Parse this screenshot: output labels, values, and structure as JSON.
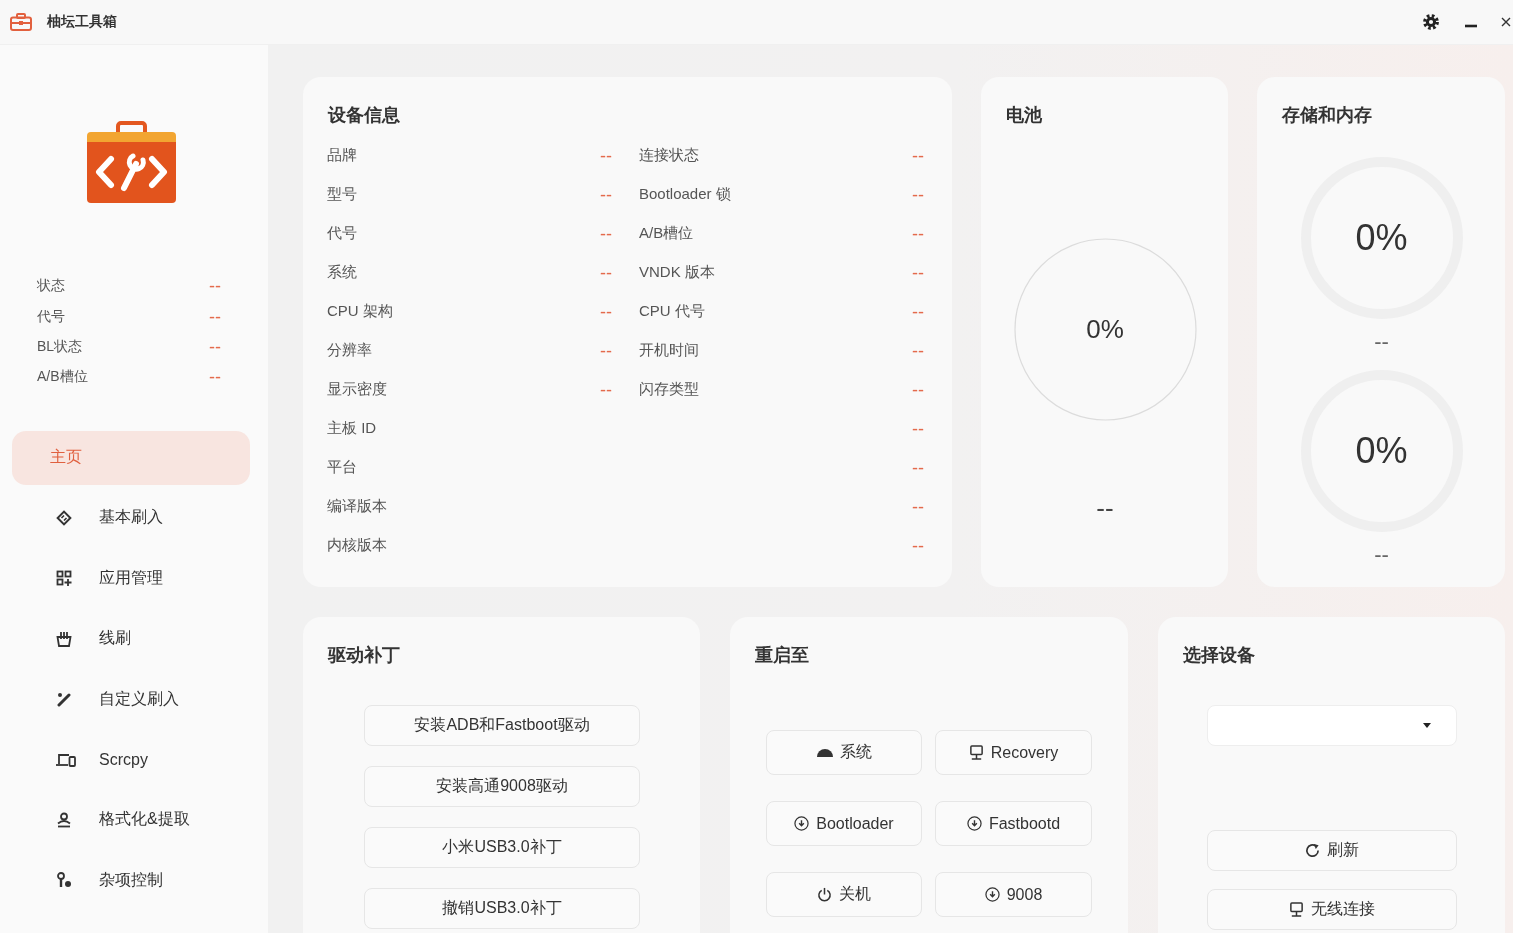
{
  "window": {
    "title": "柚坛工具箱"
  },
  "sidebar": {
    "status": [
      {
        "label": "状态",
        "value": "--"
      },
      {
        "label": "代号",
        "value": "--"
      },
      {
        "label": "BL状态",
        "value": "--"
      },
      {
        "label": "A/B槽位",
        "value": "--"
      }
    ],
    "nav": [
      {
        "label": "主页",
        "selected": true
      },
      {
        "label": "基本刷入",
        "selected": false
      },
      {
        "label": "应用管理",
        "selected": false
      },
      {
        "label": "线刷",
        "selected": false
      },
      {
        "label": "自定义刷入",
        "selected": false
      },
      {
        "label": "Scrcpy",
        "selected": false
      },
      {
        "label": "格式化&提取",
        "selected": false
      },
      {
        "label": "杂项控制",
        "selected": false
      }
    ]
  },
  "device_info": {
    "title": "设备信息",
    "rows": [
      {
        "cells": [
          {
            "label": "品牌",
            "value": "--"
          },
          {
            "label": "连接状态",
            "value": "--"
          }
        ]
      },
      {
        "cells": [
          {
            "label": "型号",
            "value": "--"
          },
          {
            "label": "Bootloader 锁",
            "value": "--"
          }
        ]
      },
      {
        "cells": [
          {
            "label": "代号",
            "value": "--"
          },
          {
            "label": "A/B槽位",
            "value": "--"
          }
        ]
      },
      {
        "cells": [
          {
            "label": "系统",
            "value": "--"
          },
          {
            "label": "VNDK 版本",
            "value": "--"
          }
        ]
      },
      {
        "cells": [
          {
            "label": "CPU 架构",
            "value": "--"
          },
          {
            "label": "CPU 代号",
            "value": "--"
          }
        ]
      },
      {
        "cells": [
          {
            "label": "分辨率",
            "value": "--"
          },
          {
            "label": "开机时间",
            "value": "--"
          }
        ]
      },
      {
        "cells": [
          {
            "label": "显示密度",
            "value": "--"
          },
          {
            "label": "闪存类型",
            "value": "--"
          }
        ]
      },
      {
        "cells": [
          {
            "label": "主板 ID",
            "value": "--"
          }
        ]
      },
      {
        "cells": [
          {
            "label": "平台",
            "value": "--"
          }
        ]
      },
      {
        "cells": [
          {
            "label": "编译版本",
            "value": "--"
          }
        ]
      },
      {
        "cells": [
          {
            "label": "内核版本",
            "value": "--"
          }
        ]
      }
    ]
  },
  "battery": {
    "title": "电池",
    "reading": "0%",
    "detail": "--"
  },
  "storage": {
    "title": "存储和内存",
    "gauges": [
      {
        "reading": "0%",
        "detail": "--"
      },
      {
        "reading": "0%",
        "detail": "--"
      }
    ]
  },
  "drivers": {
    "title": "驱动补丁",
    "buttons": [
      "安装ADB和Fastboot驱动",
      "安装高通9008驱动",
      "小米USB3.0补丁",
      "撤销USB3.0补丁"
    ]
  },
  "reboot": {
    "title": "重启至",
    "buttons": [
      "系统",
      "Recovery",
      "Bootloader",
      "Fastbootd",
      "关机",
      "9008"
    ]
  },
  "device_select": {
    "title": "选择设备",
    "buttons": [
      "刷新",
      "无线连接"
    ]
  }
}
